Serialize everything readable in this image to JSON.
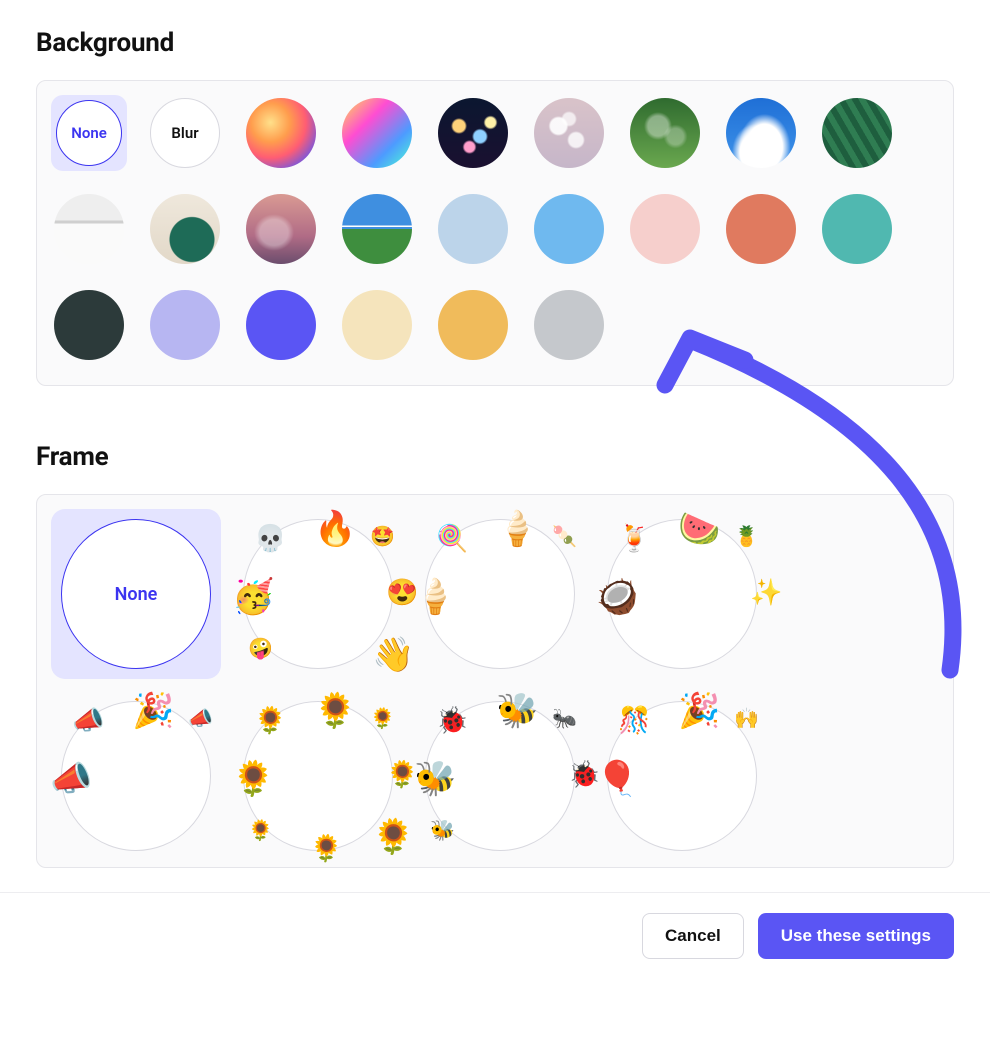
{
  "sections": {
    "background": {
      "title": "Background",
      "options": [
        {
          "id": "none",
          "kind": "label",
          "label": "None",
          "selected": true
        },
        {
          "id": "blur",
          "kind": "label",
          "label": "Blur"
        },
        {
          "id": "img-warm-gradient",
          "kind": "image",
          "name": "warm-radial-gradient"
        },
        {
          "id": "img-rainbow-gradient",
          "kind": "image",
          "name": "rainbow-diagonal-gradient"
        },
        {
          "id": "img-bokeh-night",
          "kind": "image",
          "name": "bokeh-city-lights-night"
        },
        {
          "id": "img-bokeh-pale",
          "kind": "image",
          "name": "bokeh-pale-pink"
        },
        {
          "id": "img-green-bokeh",
          "kind": "image",
          "name": "green-foliage-bokeh"
        },
        {
          "id": "img-sky-clouds",
          "kind": "image",
          "name": "blue-sky-clouds"
        },
        {
          "id": "img-palm",
          "kind": "image",
          "name": "palm-leaves"
        },
        {
          "id": "img-room-bw",
          "kind": "image",
          "name": "interior-room-bw"
        },
        {
          "id": "img-armchair",
          "kind": "image",
          "name": "green-armchair-room"
        },
        {
          "id": "img-sunset-clouds",
          "kind": "image",
          "name": "sunset-pink-clouds"
        },
        {
          "id": "img-bliss",
          "kind": "image",
          "name": "green-hills-blue-sky"
        },
        {
          "id": "color-pale-blue",
          "kind": "color",
          "color": "#bcd4ea"
        },
        {
          "id": "color-sky-blue",
          "kind": "color",
          "color": "#6fb9ef"
        },
        {
          "id": "color-blush",
          "kind": "color",
          "color": "#f6cfcc"
        },
        {
          "id": "color-coral",
          "kind": "color",
          "color": "#e07a5f"
        },
        {
          "id": "color-teal",
          "kind": "color",
          "color": "#50b8b0"
        },
        {
          "id": "color-charcoal",
          "kind": "color",
          "color": "#2c3a3a"
        },
        {
          "id": "color-lavender",
          "kind": "color",
          "color": "#b7b6f2"
        },
        {
          "id": "color-indigo",
          "kind": "color",
          "color": "#5a55f4"
        },
        {
          "id": "color-cream",
          "kind": "color",
          "color": "#f5e4bc"
        },
        {
          "id": "color-amber",
          "kind": "color",
          "color": "#f0bb5b"
        },
        {
          "id": "color-silver",
          "kind": "color",
          "color": "#c5c8cc"
        }
      ]
    },
    "frame": {
      "title": "Frame",
      "options": [
        {
          "id": "frame-none",
          "label": "None",
          "selected": true,
          "decorations": []
        },
        {
          "id": "frame-emoji-faces",
          "label": "",
          "decorations": [
            "🔥",
            "💀",
            "🤩",
            "🥳",
            "😍",
            "🤪",
            "👋"
          ]
        },
        {
          "id": "frame-icecream",
          "label": "",
          "decorations": [
            "🍦",
            "🍭",
            "🍡",
            "🍦"
          ]
        },
        {
          "id": "frame-tropical",
          "label": "",
          "decorations": [
            "🍉",
            "🍹",
            "🍍",
            "🥥",
            "✨"
          ]
        },
        {
          "id": "frame-party",
          "label": "",
          "decorations": [
            "🎉",
            "📣",
            "📣",
            "📣"
          ]
        },
        {
          "id": "frame-sunflowers",
          "label": "",
          "decorations": [
            "🌻",
            "🌻",
            "🌻",
            "🌻",
            "🌻",
            "🌻",
            "🌻",
            "🌻"
          ]
        },
        {
          "id": "frame-bugs",
          "label": "",
          "decorations": [
            "🐝",
            "🐞",
            "🐜",
            "🐝",
            "🐞",
            "🐝"
          ]
        },
        {
          "id": "frame-celebrate",
          "label": "",
          "decorations": [
            "🎉",
            "🎊",
            "🙌",
            "🎈"
          ]
        }
      ]
    }
  },
  "footer": {
    "cancel_label": "Cancel",
    "apply_label": "Use these settings"
  },
  "annotation": {
    "arrow_color": "#5a55f4"
  }
}
